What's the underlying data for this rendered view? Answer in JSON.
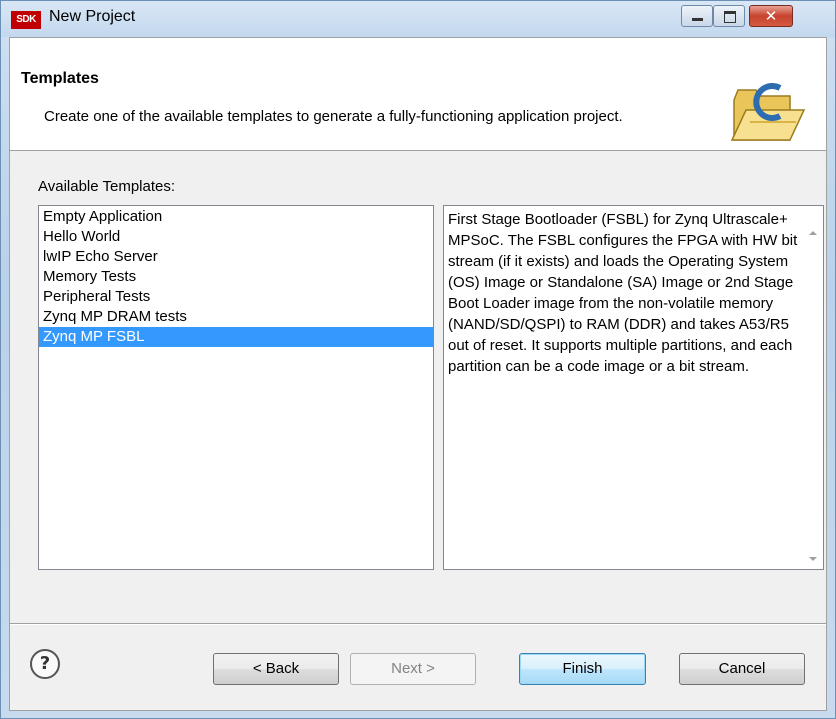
{
  "window": {
    "title": "New Project",
    "app_icon_text": "SDK",
    "close_symbol": "✕"
  },
  "header": {
    "title": "Templates",
    "description": "Create one of the available templates to generate a fully-functioning application project.",
    "icon": "folder-icon"
  },
  "templates": {
    "label": "Available Templates:",
    "items": [
      "Empty Application",
      "Hello World",
      "lwIP Echo Server",
      "Memory Tests",
      "Peripheral Tests",
      "Zynq MP DRAM tests",
      "Zynq MP FSBL"
    ],
    "selected": "Zynq MP FSBL",
    "description": "First Stage Bootloader (FSBL) for Zynq Ultrascale+ MPSoC. The FSBL configures the FPGA with HW bit stream (if it exists) and loads the Operating System (OS) Image or Standalone (SA) Image or 2nd Stage Boot Loader image from the non-volatile memory (NAND/SD/QSPI) to RAM (DDR) and takes A53/R5 out of reset. It supports multiple partitions,  and each partition can be a code image or a bit stream."
  },
  "buttons": {
    "help": "?",
    "back": "< Back",
    "next": "Next >",
    "finish": "Finish",
    "cancel": "Cancel"
  },
  "colors": {
    "selection": "#3399ff",
    "close_button": "#c7432e",
    "brand_icon": "#c00000"
  }
}
